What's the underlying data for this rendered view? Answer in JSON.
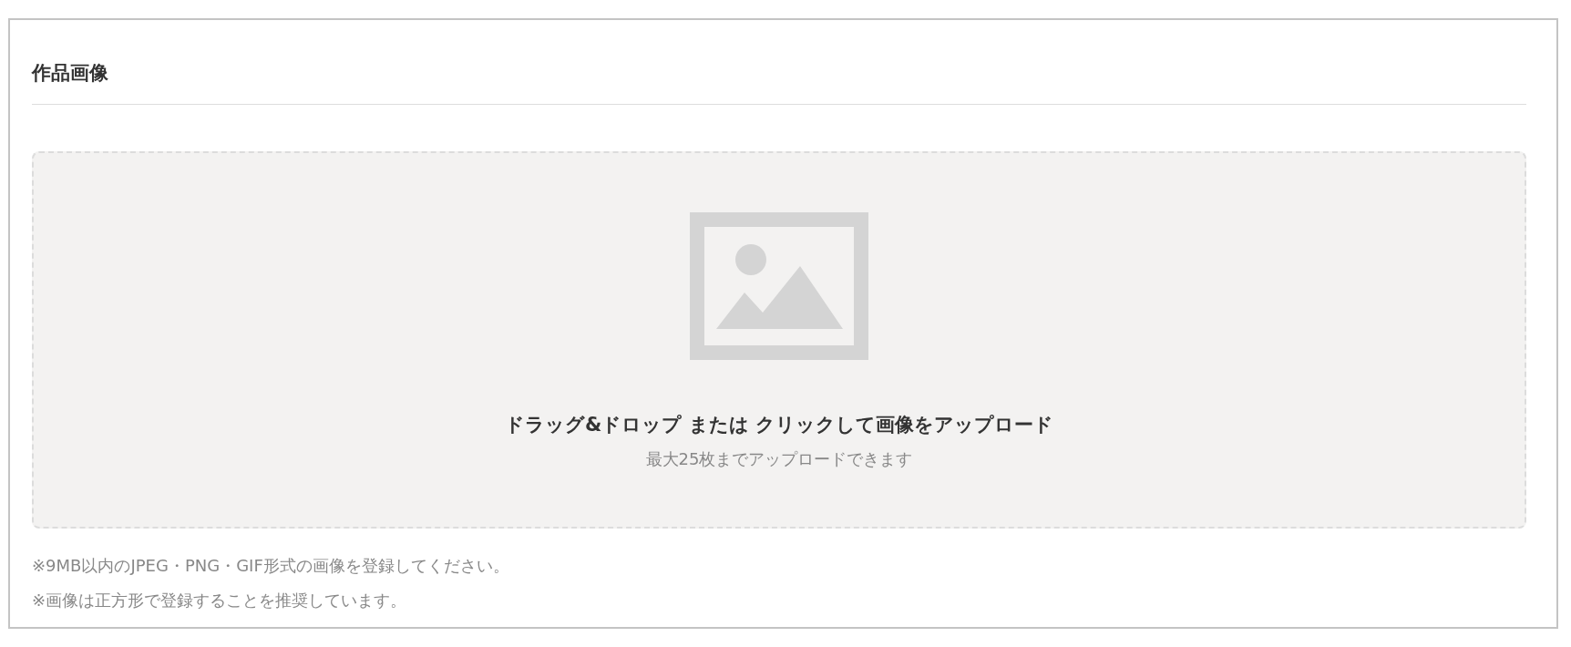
{
  "section": {
    "title": "作品画像"
  },
  "dropzone": {
    "instruction": "ドラッグ&ドロップ または クリックして画像をアップロード",
    "limit": "最大25枚までアップロードできます"
  },
  "notes": [
    "※9MB以内のJPEG・PNG・GIF形式の画像を登録してください。",
    "※画像は正方形で登録することを推奨しています。"
  ]
}
